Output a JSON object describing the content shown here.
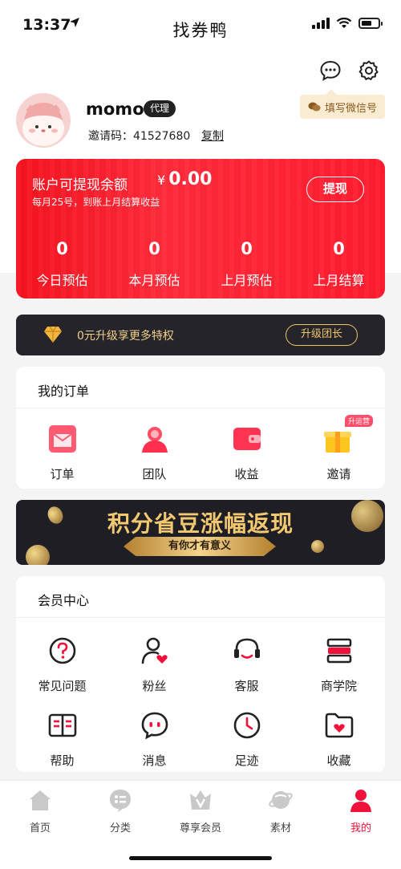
{
  "status_bar": {
    "time": "13:37"
  },
  "nav": {
    "title": "找券鸭"
  },
  "profile": {
    "username": "momo",
    "role": "代理",
    "invite_label": "邀请码：41527680",
    "copy_label": "复制",
    "wechat_label": "填写微信号"
  },
  "balance": {
    "label": "账户可提现余额",
    "currency": "¥",
    "amount": "0.00",
    "subtitle": "每月25号，到账上月结算收益",
    "withdraw_label": "提现",
    "stats": [
      {
        "value": "0",
        "label": "今日预估"
      },
      {
        "value": "0",
        "label": "本月预估"
      },
      {
        "value": "0",
        "label": "上月预估"
      },
      {
        "value": "0",
        "label": "上月结算"
      }
    ]
  },
  "upgrade": {
    "text": "0元升级享更多特权",
    "button": "升级团长"
  },
  "orders": {
    "title": "我的订单",
    "items": [
      {
        "label": "订单",
        "icon": "order-icon"
      },
      {
        "label": "团队",
        "icon": "team-icon"
      },
      {
        "label": "收益",
        "icon": "wallet-icon"
      },
      {
        "label": "邀请",
        "icon": "gift-icon",
        "badge": "升运营"
      }
    ]
  },
  "banner": {
    "title": "积分省豆涨幅返现",
    "subtitle": "有你才有意义"
  },
  "member": {
    "title": "会员中心",
    "items": [
      {
        "label": "常见问题",
        "icon": "question-icon"
      },
      {
        "label": "粉丝",
        "icon": "fans-icon"
      },
      {
        "label": "客服",
        "icon": "headset-icon"
      },
      {
        "label": "商学院",
        "icon": "books-icon"
      },
      {
        "label": "帮助",
        "icon": "help-book-icon"
      },
      {
        "label": "消息",
        "icon": "message-icon"
      },
      {
        "label": "足迹",
        "icon": "clock-icon"
      },
      {
        "label": "收藏",
        "icon": "folder-heart-icon"
      }
    ]
  },
  "tabbar": {
    "tabs": [
      {
        "label": "首页",
        "icon": "home-icon"
      },
      {
        "label": "分类",
        "icon": "category-icon"
      },
      {
        "label": "尊享会员",
        "icon": "vip-icon"
      },
      {
        "label": "素材",
        "icon": "planet-icon"
      },
      {
        "label": "我的",
        "icon": "profile-icon",
        "active": true
      }
    ]
  },
  "colors": {
    "accent": "#f0123a",
    "gold": "#f0c56a",
    "dark": "#25242b"
  }
}
